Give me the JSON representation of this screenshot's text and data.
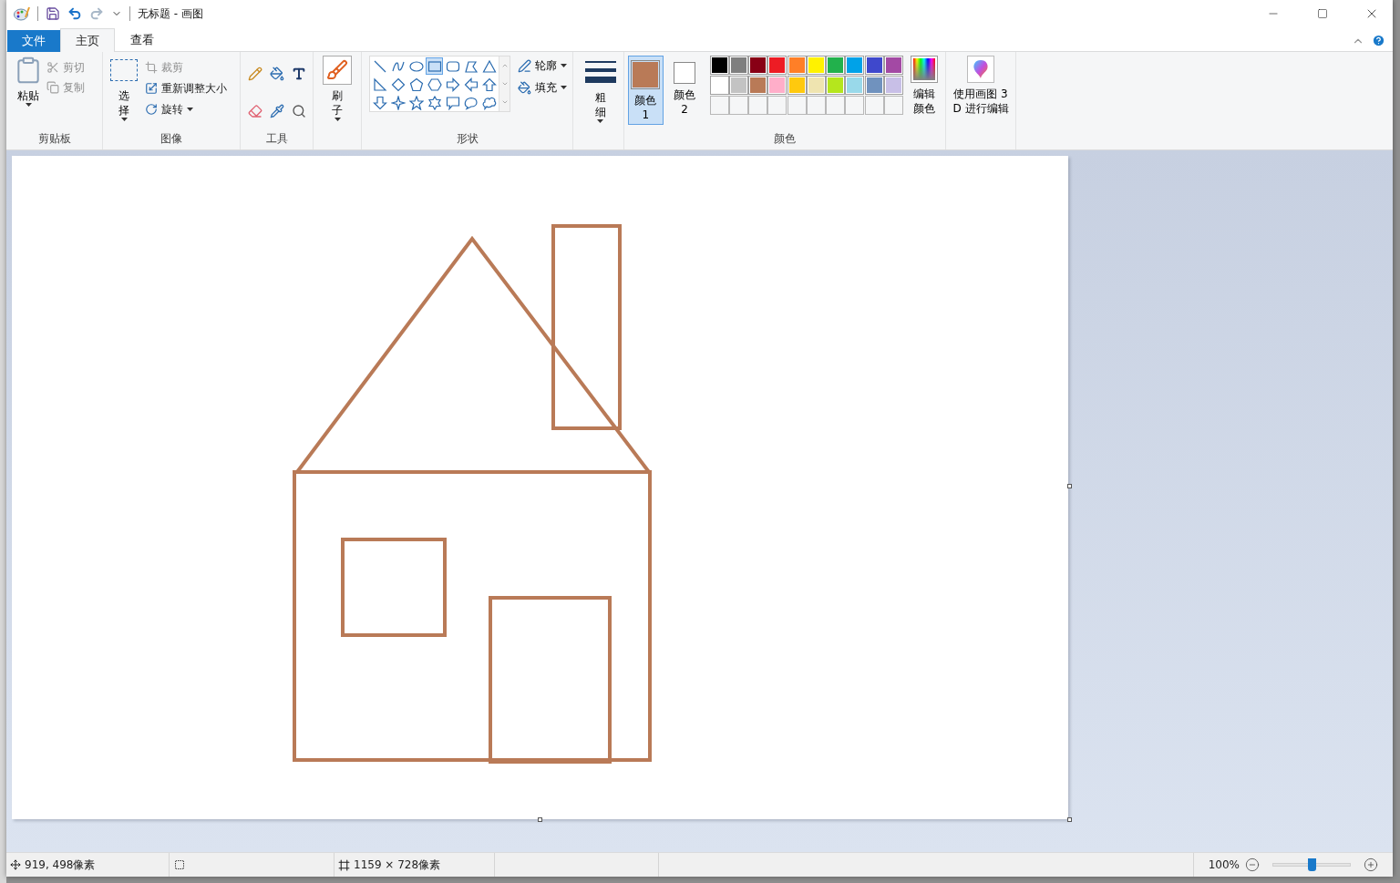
{
  "window": {
    "title": "无标题 - 画图"
  },
  "tabs": [
    {
      "label": "文件",
      "kind": "file",
      "selected": false
    },
    {
      "label": "主页",
      "kind": "tab",
      "selected": true
    },
    {
      "label": "查看",
      "kind": "tab",
      "selected": false
    }
  ],
  "clipboard": {
    "paste": "粘贴",
    "items": [
      {
        "label": "剪切",
        "kind": "cut",
        "disabled": true
      },
      {
        "label": "复制",
        "kind": "copy",
        "disabled": true
      }
    ],
    "group_label": "剪贴板"
  },
  "image": {
    "select": "选择",
    "items": [
      {
        "label": "裁剪",
        "kind": "crop",
        "disabled": true,
        "dropdown": false
      },
      {
        "label": "重新调整大小",
        "kind": "resize",
        "disabled": false,
        "dropdown": false
      },
      {
        "label": "旋转",
        "kind": "rotate",
        "disabled": false,
        "dropdown": true
      }
    ],
    "group_label": "图像"
  },
  "tools": {
    "group_label": "工具"
  },
  "brushes": {
    "label": "刷子"
  },
  "shapes": {
    "gallery": [
      {
        "kind": "line",
        "selected": false
      },
      {
        "kind": "curve",
        "selected": false
      },
      {
        "kind": "oval",
        "selected": false
      },
      {
        "kind": "rectangle",
        "selected": true
      },
      {
        "kind": "rounded-rectangle",
        "selected": false
      },
      {
        "kind": "polygon",
        "selected": false
      },
      {
        "kind": "triangle",
        "selected": false
      },
      {
        "kind": "right-triangle",
        "selected": false
      },
      {
        "kind": "diamond",
        "selected": false
      },
      {
        "kind": "pentagon",
        "selected": false
      },
      {
        "kind": "hexagon",
        "selected": false
      },
      {
        "kind": "arrow-right",
        "selected": false
      },
      {
        "kind": "arrow-left",
        "selected": false
      },
      {
        "kind": "arrow-up",
        "selected": false
      },
      {
        "kind": "arrow-down",
        "selected": false
      },
      {
        "kind": "star4",
        "selected": false
      },
      {
        "kind": "star5",
        "selected": false
      },
      {
        "kind": "star6",
        "selected": false
      },
      {
        "kind": "callout-rect",
        "selected": false
      },
      {
        "kind": "callout-oval",
        "selected": false
      },
      {
        "kind": "callout-cloud",
        "selected": false
      }
    ],
    "outline": "轮廓",
    "fill": "填充",
    "group_label": "形状"
  },
  "size": {
    "label": "粗细"
  },
  "colors": {
    "color1": {
      "label": "颜色 1",
      "color": "#b97a57",
      "selected": true
    },
    "color2": {
      "label": "颜色 2",
      "color": "#ffffff",
      "selected": false
    },
    "palette": [
      {
        "color": "#000000"
      },
      {
        "color": "#7f7f7f"
      },
      {
        "color": "#880015"
      },
      {
        "color": "#ed1c24"
      },
      {
        "color": "#ff7f27"
      },
      {
        "color": "#fff200"
      },
      {
        "color": "#22b14c"
      },
      {
        "color": "#00a2e8"
      },
      {
        "color": "#3f48cc"
      },
      {
        "color": "#a349a4"
      },
      {
        "color": "#ffffff"
      },
      {
        "color": "#c3c3c3"
      },
      {
        "color": "#b97a57"
      },
      {
        "color": "#ffaec9"
      },
      {
        "color": "#ffc90e"
      },
      {
        "color": "#efe4b0"
      },
      {
        "color": "#b5e61d"
      },
      {
        "color": "#99d9ea"
      },
      {
        "color": "#7092be"
      },
      {
        "color": "#c8bfe7"
      }
    ],
    "custom": [
      {
        "kind": "empty"
      },
      {
        "kind": "empty"
      },
      {
        "kind": "empty"
      },
      {
        "kind": "empty"
      },
      {
        "kind": "empty"
      },
      {
        "kind": "empty"
      },
      {
        "kind": "empty"
      },
      {
        "kind": "empty"
      },
      {
        "kind": "empty"
      },
      {
        "kind": "empty"
      }
    ],
    "edit": "编辑颜色",
    "group_label": "颜色"
  },
  "paint3d": {
    "label": "使用画图 3 D 进行编辑"
  },
  "status_bar": {
    "position": "919, 498像素",
    "canvas_size": "1159 × 728像素",
    "zoom": "100%",
    "zoom_slider": {
      "level": 0.5
    }
  }
}
